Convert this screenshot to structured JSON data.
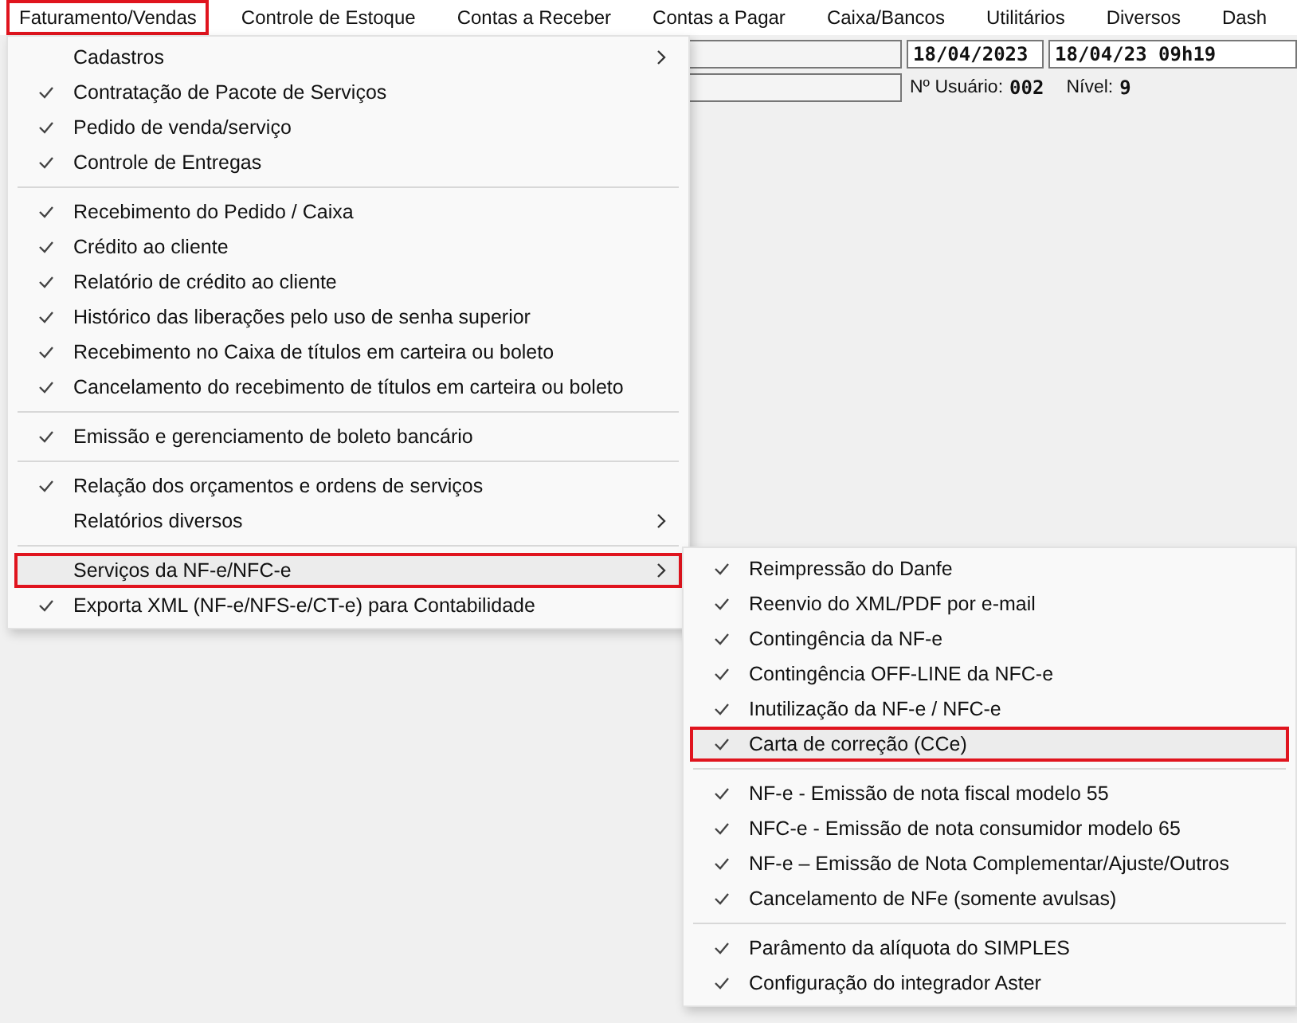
{
  "menubar": [
    {
      "label": "Faturamento/Vendas",
      "selected": true
    },
    {
      "label": "Controle de Estoque",
      "selected": false
    },
    {
      "label": "Contas a Receber",
      "selected": false
    },
    {
      "label": "Contas a Pagar",
      "selected": false
    },
    {
      "label": "Caixa/Bancos",
      "selected": false
    },
    {
      "label": "Utilitários",
      "selected": false
    },
    {
      "label": "Diversos",
      "selected": false
    },
    {
      "label": "Dash",
      "selected": false
    }
  ],
  "header": {
    "date": "18/04/2023",
    "datetime": "18/04/23 09h19",
    "user_label": "Nº Usuário:",
    "user": "002",
    "level_label": "Nível:",
    "level_value": "9"
  },
  "menu": [
    {
      "kind": "item",
      "label": "Cadastros",
      "checked": false,
      "submenu": true,
      "selected": false
    },
    {
      "kind": "item",
      "label": "Contratação de Pacote de Serviços",
      "checked": true,
      "submenu": false,
      "selected": false
    },
    {
      "kind": "item",
      "label": "Pedido de venda/serviço",
      "checked": true,
      "submenu": false,
      "selected": false
    },
    {
      "kind": "item",
      "label": "Controle de Entregas",
      "checked": true,
      "submenu": false,
      "selected": false
    },
    {
      "kind": "separator"
    },
    {
      "kind": "item",
      "label": "Recebimento do Pedido / Caixa",
      "checked": true,
      "submenu": false,
      "selected": false
    },
    {
      "kind": "item",
      "label": "Crédito ao cliente",
      "checked": true,
      "submenu": false,
      "selected": false
    },
    {
      "kind": "item",
      "label": "Relatório de crédito ao cliente",
      "checked": true,
      "submenu": false,
      "selected": false
    },
    {
      "kind": "item",
      "label": "Histórico das liberações pelo uso de senha superior",
      "checked": true,
      "submenu": false,
      "selected": false
    },
    {
      "kind": "item",
      "label": "Recebimento no Caixa de títulos em carteira ou boleto",
      "checked": true,
      "submenu": false,
      "selected": false
    },
    {
      "kind": "item",
      "label": "Cancelamento do recebimento de títulos em carteira ou boleto",
      "checked": true,
      "submenu": false,
      "selected": false
    },
    {
      "kind": "separator"
    },
    {
      "kind": "item",
      "label": "Emissão e gerenciamento de boleto bancário",
      "checked": true,
      "submenu": false,
      "selected": false
    },
    {
      "kind": "separator"
    },
    {
      "kind": "item",
      "label": "Relação dos orçamentos e ordens de serviços",
      "checked": true,
      "submenu": false,
      "selected": false
    },
    {
      "kind": "item",
      "label": "Relatórios diversos",
      "checked": false,
      "submenu": true,
      "selected": false
    },
    {
      "kind": "separator"
    },
    {
      "kind": "item",
      "label": "Serviços da NF-e/NFC-e",
      "checked": false,
      "submenu": true,
      "selected": true
    },
    {
      "kind": "item",
      "label": "Exporta XML (NF-e/NFS-e/CT-e) para Contabilidade",
      "checked": true,
      "submenu": false,
      "selected": false
    }
  ],
  "submenu": [
    {
      "kind": "item",
      "label": "Reimpressão do Danfe",
      "checked": true,
      "submenu": false,
      "selected": false
    },
    {
      "kind": "item",
      "label": "Reenvio do XML/PDF por e-mail",
      "checked": true,
      "submenu": false,
      "selected": false
    },
    {
      "kind": "item",
      "label": "Contingência da NF-e",
      "checked": true,
      "submenu": false,
      "selected": false
    },
    {
      "kind": "item",
      "label": "Contingência OFF-LINE da NFC-e",
      "checked": true,
      "submenu": false,
      "selected": false
    },
    {
      "kind": "item",
      "label": "Inutilização da NF-e / NFC-e",
      "checked": true,
      "submenu": false,
      "selected": false
    },
    {
      "kind": "item",
      "label": "Carta de correção (CCe)",
      "checked": true,
      "submenu": false,
      "selected": true
    },
    {
      "kind": "separator"
    },
    {
      "kind": "item",
      "label": "NF-e - Emissão de nota fiscal modelo 55",
      "checked": true,
      "submenu": false,
      "selected": false
    },
    {
      "kind": "item",
      "label": "NFC-e - Emissão de nota consumidor modelo 65",
      "checked": true,
      "submenu": false,
      "selected": false
    },
    {
      "kind": "item",
      "label": "NF-e – Emissão de Nota Complementar/Ajuste/Outros",
      "checked": true,
      "submenu": false,
      "selected": false
    },
    {
      "kind": "item",
      "label": "Cancelamento de NFe (somente avulsas)",
      "checked": true,
      "submenu": false,
      "selected": false
    },
    {
      "kind": "separator"
    },
    {
      "kind": "item",
      "label": "Parâmento da alíquota do SIMPLES",
      "checked": true,
      "submenu": false,
      "selected": false
    },
    {
      "kind": "item",
      "label": "Configuração do integrador Aster",
      "checked": true,
      "submenu": false,
      "selected": false
    }
  ]
}
